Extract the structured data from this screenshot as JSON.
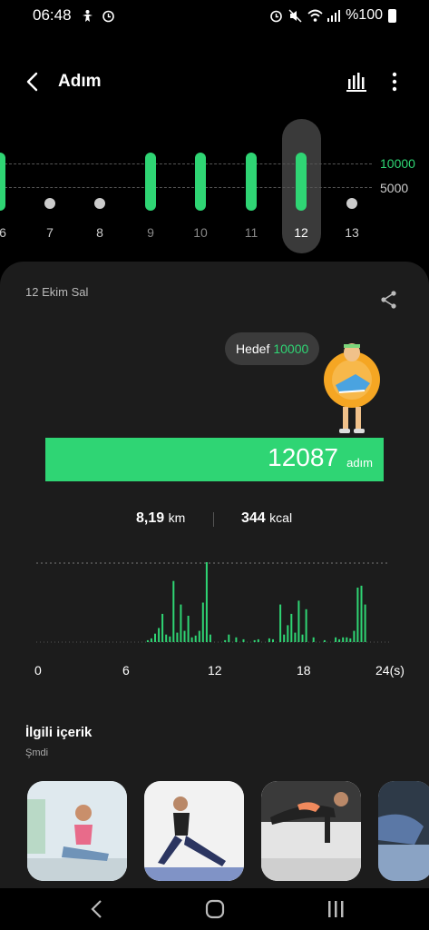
{
  "status_bar": {
    "time": "06:48",
    "battery": "%100",
    "left_icons": [
      "accessibility-icon",
      "alarm-icon"
    ],
    "right_icons": [
      "alarm-icon",
      "mute-icon",
      "wifi-icon",
      "signal-icon",
      "battery-icon"
    ]
  },
  "app_bar": {
    "title": "Adım"
  },
  "week": {
    "goal_high": "10000",
    "goal_low": "5000",
    "days": [
      {
        "label": "6",
        "value": 1.0
      },
      {
        "label": "7",
        "value": 0.0
      },
      {
        "label": "8",
        "value": 0.0
      },
      {
        "label": "9",
        "value": 1.0
      },
      {
        "label": "10",
        "value": 1.0
      },
      {
        "label": "11",
        "value": 1.0
      },
      {
        "label": "12",
        "value": 1.0
      },
      {
        "label": "13",
        "value": 0.0
      }
    ],
    "selected": "12"
  },
  "detail": {
    "date": "12 Ekim Sal",
    "goal_text": "Hedef",
    "goal_value": "10000",
    "steps": "12087",
    "steps_unit": "adım",
    "distance": "8,19",
    "distance_unit": "km",
    "calories": "344",
    "calories_unit": "kcal"
  },
  "chart_data": {
    "type": "bar",
    "x_ticks": [
      "0",
      "6",
      "12",
      "18",
      "24(s)"
    ],
    "x_range": [
      0,
      24
    ],
    "bins_per_hour": 4,
    "values": [
      0,
      0,
      0,
      0,
      0,
      0,
      0,
      0,
      0,
      0,
      0,
      0,
      0,
      0,
      0,
      0,
      0,
      0,
      0,
      0,
      0,
      0,
      0,
      0,
      0,
      0,
      0,
      0,
      0,
      0,
      2,
      4,
      9,
      15,
      30,
      8,
      6,
      65,
      10,
      40,
      12,
      28,
      5,
      7,
      12,
      42,
      85,
      8,
      0,
      0,
      0,
      2,
      8,
      0,
      5,
      0,
      3,
      0,
      0,
      2,
      3,
      0,
      0,
      4,
      3,
      0,
      40,
      8,
      18,
      30,
      10,
      44,
      8,
      35,
      0,
      5,
      0,
      0,
      2,
      0,
      0,
      5,
      3,
      5,
      5,
      4,
      12,
      58,
      60,
      40,
      0,
      0,
      0,
      0,
      0,
      0
    ]
  },
  "related": {
    "title": "İlgili içerik",
    "subtitle": "Şmdi"
  },
  "colors": {
    "accent": "#2fd574",
    "card": "#1c1c1c",
    "muted_bar": "#cccccc"
  }
}
